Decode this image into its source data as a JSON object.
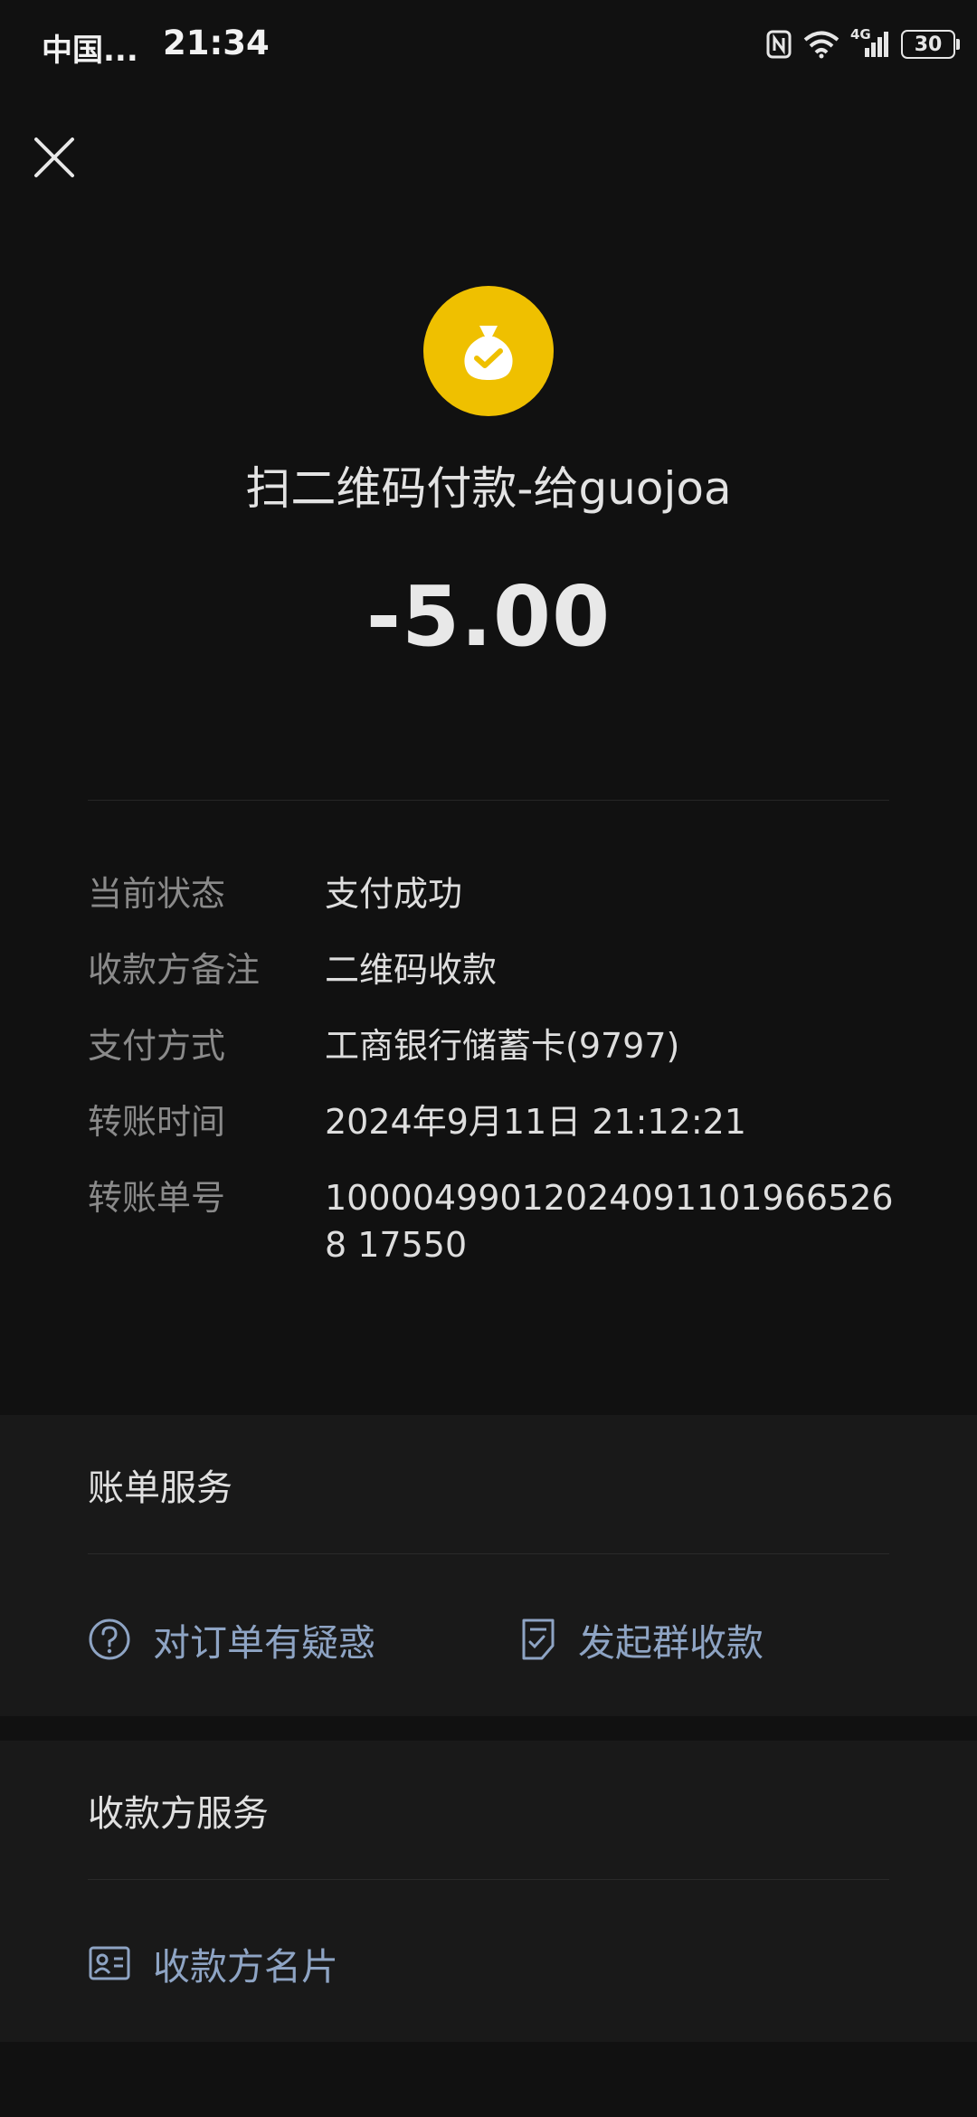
{
  "status_bar": {
    "carrier": "中国...",
    "time": "21:34",
    "network": "4G",
    "battery": "30"
  },
  "header": {
    "close_icon": "close-icon"
  },
  "transaction": {
    "logo_icon": "money-bag-check-icon",
    "title": "扫二维码付款-给guojoa",
    "amount": "-5.00"
  },
  "details": [
    {
      "label": "当前状态",
      "value": "支付成功"
    },
    {
      "label": "收款方备注",
      "value": "二维码收款"
    },
    {
      "label": "支付方式",
      "value": "工商银行储蓄卡(9797)"
    },
    {
      "label": "转账时间",
      "value": "2024年9月11日 21:12:21"
    },
    {
      "label": "转账单号",
      "value": "100004990120240911019665268 17550"
    }
  ],
  "bill_service": {
    "header": "账单服务",
    "actions": [
      {
        "label": "对订单有疑惑",
        "icon": "question-circle-icon"
      },
      {
        "label": "发起群收款",
        "icon": "checklist-doc-icon"
      }
    ]
  },
  "payee_service": {
    "header": "收款方服务",
    "actions": [
      {
        "label": "收款方名片",
        "icon": "contact-card-icon"
      }
    ]
  },
  "colors": {
    "background": "#111111",
    "section_background": "#191919",
    "logo_yellow": "#efc000",
    "link_blue": "#8ea4c4",
    "label_gray": "#8a8a8a"
  }
}
